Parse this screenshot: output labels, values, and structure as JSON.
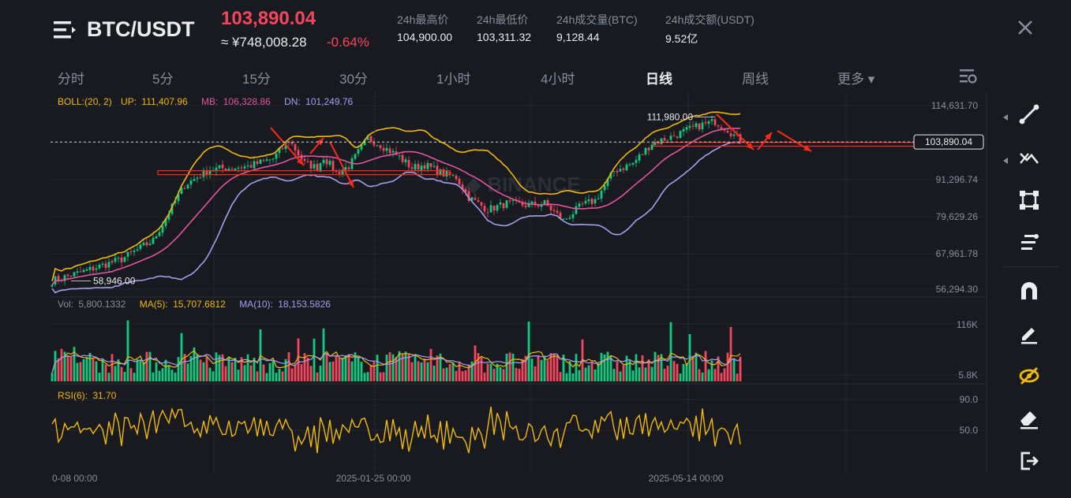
{
  "header": {
    "menu_icon": "menu-icon",
    "symbol": "BTC/USDT",
    "last_price": "103,890.04",
    "cny_price": "≈ ¥748,008.28",
    "change_pct": "-0.64%",
    "stats": [
      {
        "label": "24h最高价",
        "value": "104,900.00"
      },
      {
        "label": "24h最低价",
        "value": "103,311.32"
      },
      {
        "label": "24h成交量(BTC)",
        "value": "9,128.44"
      },
      {
        "label": "24h成交额(USDT)",
        "value": "9.52亿"
      }
    ],
    "close_icon": "close-icon"
  },
  "timeframes": [
    "分时",
    "5分",
    "15分",
    "30分",
    "1小时",
    "4小时",
    "日线",
    "周线",
    "更多 ▾"
  ],
  "active_timeframe": "日线",
  "tools": [
    "trendline-icon",
    "multi-line-icon",
    "rectangle-icon",
    "text-lines-icon",
    "magnet-icon",
    "pencil-icon",
    "hide-eye-icon",
    "eraser-icon",
    "exit-icon"
  ],
  "colors": {
    "background": "#181a20",
    "up": "#0ecb81",
    "down": "#f6465d",
    "boll_up": "#f0b90b",
    "boll_mb": "#e056a0",
    "boll_dn": "#a99cf0",
    "annotation": "#ff2a1a"
  },
  "chart_data": [
    {
      "type": "candlestick",
      "indicator": "BOLL:(20, 2)",
      "legend": [
        {
          "name": "BOLL:(20, 2)",
          "value": ""
        },
        {
          "name": "UP:",
          "value": "111,407.96"
        },
        {
          "name": "MB:",
          "value": "106,328.86"
        },
        {
          "name": "DN:",
          "value": "101,249.76"
        }
      ],
      "y_ticks": [
        "114,631.70",
        "91,296.74",
        "79,629.26",
        "67,961.78",
        "56,294.30"
      ],
      "y_tick_values": [
        114631.7,
        91296.74,
        79629.26,
        67961.78,
        56294.3
      ],
      "ylim": [
        56294.3,
        114631.7
      ],
      "current_price_label": "103,890.04",
      "current_price": 103890.04,
      "max_label": "111,980.00",
      "max_value": 111980,
      "min_label": "58,946.00",
      "min_value": 58946,
      "anchors": [
        {
          "i": 0,
          "v": 59000
        },
        {
          "i": 10,
          "v": 62000
        },
        {
          "i": 22,
          "v": 66000
        },
        {
          "i": 32,
          "v": 72000
        },
        {
          "i": 42,
          "v": 90000
        },
        {
          "i": 50,
          "v": 95000
        },
        {
          "i": 62,
          "v": 96000
        },
        {
          "i": 70,
          "v": 98500
        },
        {
          "i": 75,
          "v": 104500
        },
        {
          "i": 80,
          "v": 97000
        },
        {
          "i": 84,
          "v": 95500
        },
        {
          "i": 86,
          "v": 99000
        },
        {
          "i": 90,
          "v": 94000
        },
        {
          "i": 94,
          "v": 96000
        },
        {
          "i": 100,
          "v": 105000
        },
        {
          "i": 104,
          "v": 103000
        },
        {
          "i": 110,
          "v": 99000
        },
        {
          "i": 114,
          "v": 95500
        },
        {
          "i": 118,
          "v": 96500
        },
        {
          "i": 124,
          "v": 93500
        },
        {
          "i": 128,
          "v": 92500
        },
        {
          "i": 132,
          "v": 86000
        },
        {
          "i": 138,
          "v": 82000
        },
        {
          "i": 144,
          "v": 84000
        },
        {
          "i": 150,
          "v": 83500
        },
        {
          "i": 156,
          "v": 84000
        },
        {
          "i": 162,
          "v": 78500
        },
        {
          "i": 168,
          "v": 83500
        },
        {
          "i": 172,
          "v": 85000
        },
        {
          "i": 178,
          "v": 94500
        },
        {
          "i": 184,
          "v": 97000
        },
        {
          "i": 190,
          "v": 103500
        },
        {
          "i": 196,
          "v": 105500
        },
        {
          "i": 202,
          "v": 108000
        },
        {
          "i": 206,
          "v": 109500
        },
        {
          "i": 210,
          "v": 110500
        },
        {
          "i": 214,
          "v": 108000
        },
        {
          "i": 218,
          "v": 104000
        }
      ],
      "n_candles": 219
    },
    {
      "type": "bar",
      "indicator": "Volume",
      "legend": [
        {
          "name": "Vol:",
          "value": "5,800.1332"
        },
        {
          "name": "MA(5):",
          "value": "15,707.6812"
        },
        {
          "name": "MA(10):",
          "value": "18,153.5826"
        }
      ],
      "y_ticks": [
        "116K",
        "5.8K"
      ],
      "y_tick_values": [
        116000,
        5800
      ]
    },
    {
      "type": "line",
      "indicator": "RSI(6)",
      "legend": [
        {
          "name": "RSI(6):",
          "value": "31.70"
        }
      ],
      "y_ticks": [
        "90.0",
        "50.0"
      ],
      "y_tick_values": [
        90,
        50
      ],
      "last_value": 31.7
    }
  ],
  "x_ticks": [
    "0-08 00:00",
    "2025-01-25 00:00",
    "2025-05-14 00:00"
  ]
}
